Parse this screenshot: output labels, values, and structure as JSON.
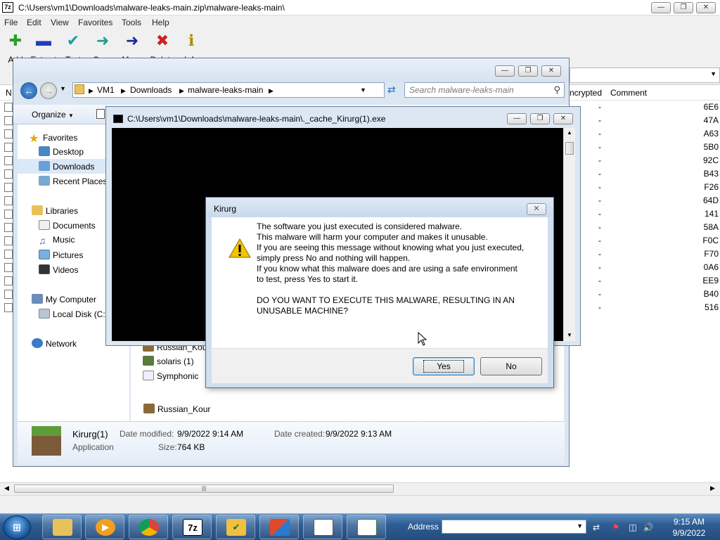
{
  "sevenzip": {
    "app_icon": "7z",
    "title": "C:\\Users\\vm1\\Downloads\\malware-leaks-main.zip\\malware-leaks-main\\",
    "menu": [
      "File",
      "Edit",
      "View",
      "Favorites",
      "Tools",
      "Help"
    ],
    "toolbar": [
      {
        "label": "Add",
        "icon": "plus-icon",
        "color": "#2aa02a"
      },
      {
        "label": "Extract",
        "icon": "minus-icon",
        "color": "#1f3fb8"
      },
      {
        "label": "Test",
        "icon": "check-icon",
        "color": "#1aa0a0"
      },
      {
        "label": "Copy",
        "icon": "arrow-right-icon",
        "color": "#1aa08a"
      },
      {
        "label": "Move",
        "icon": "arrow-right-icon",
        "color": "#1a2a9a"
      },
      {
        "label": "Delete",
        "icon": "x-icon",
        "color": "#d02020"
      },
      {
        "label": "Info",
        "icon": "info-icon",
        "color": "#b08a00"
      }
    ],
    "list_header": {
      "first_col": "N",
      "encrypted": "ncrypted",
      "comment": "Comment"
    },
    "rows": [
      {
        "encrypted": "-",
        "crc": "6E6"
      },
      {
        "encrypted": "-",
        "crc": "47A"
      },
      {
        "encrypted": "-",
        "crc": "A63"
      },
      {
        "encrypted": "-",
        "crc": "5B0"
      },
      {
        "encrypted": "-",
        "crc": "92C"
      },
      {
        "encrypted": "-",
        "crc": "B43"
      },
      {
        "encrypted": "-",
        "crc": "F26"
      },
      {
        "encrypted": "-",
        "crc": "64D"
      },
      {
        "encrypted": "-",
        "crc": "141"
      },
      {
        "encrypted": "-",
        "crc": "58A"
      },
      {
        "encrypted": "-",
        "crc": "F0C"
      },
      {
        "encrypted": "-",
        "crc": "F70"
      },
      {
        "encrypted": "-",
        "crc": "0A6"
      },
      {
        "encrypted": "-",
        "crc": "EE9"
      },
      {
        "encrypted": "-",
        "crc": "B40"
      },
      {
        "encrypted": "-",
        "crc": "516"
      }
    ],
    "scroll_grip": "|||"
  },
  "explorer": {
    "breadcrumb": [
      "VM1",
      "Downloads",
      "malware-leaks-main"
    ],
    "search_placeholder": "Search malware-leaks-main",
    "organize": "Organize",
    "nav": {
      "favorites": "Favorites",
      "desktop": "Desktop",
      "downloads": "Downloads",
      "recent": "Recent Places",
      "libraries": "Libraries",
      "documents": "Documents",
      "music": "Music",
      "pictures": "Pictures",
      "videos": "Videos",
      "my_computer": "My Computer",
      "local_disk": "Local Disk (C:)",
      "network": "Network"
    },
    "files": [
      "Russian_Kour",
      "solaris (1)",
      "Symphonic"
    ],
    "details": {
      "name": "Kirurg(1)",
      "type": "Application",
      "modified_label": "Date modified:",
      "modified": "9/9/2022 9:14 AM",
      "created_label": "Date created:",
      "created": "9/9/2022 9:13 AM",
      "size_label": "Size:",
      "size": "764 KB"
    }
  },
  "console": {
    "title": "C:\\Users\\vm1\\Downloads\\malware-leaks-main\\._cache_Kirurg(1).exe"
  },
  "dialog": {
    "title": "Kirurg",
    "lines": [
      "The software you just executed is considered malware.",
      "This malware will harm your computer and makes it unusable.",
      "If you are seeing this message without knowing what you just executed,",
      "simply press No and nothing will happen.",
      "If you know what this malware does and are using a safe environment",
      "to test, press Yes to start it.",
      "DO YOU WANT TO EXECUTE THIS MALWARE, RESULTING IN AN",
      "UNUSABLE MACHINE?"
    ],
    "yes": "Yes",
    "no": "No"
  },
  "taskbar": {
    "address_label": "Address",
    "time": "9:15 AM",
    "date": "9/9/2022",
    "app_7z": "7z"
  }
}
